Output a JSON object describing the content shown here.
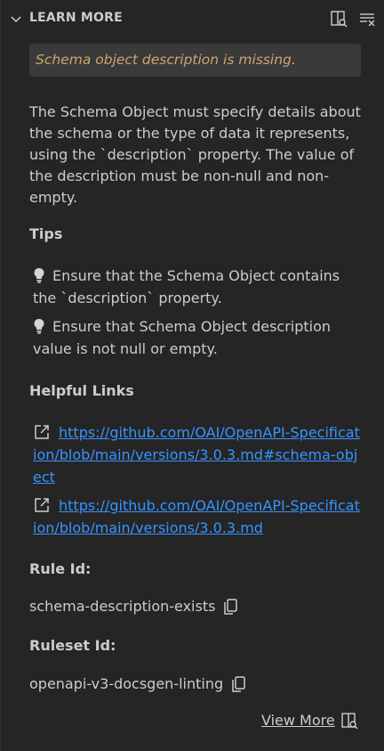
{
  "header": {
    "title": "LEARN MORE",
    "icons": [
      "chevron-down-icon",
      "open-preview-icon",
      "clear-all-icon"
    ]
  },
  "warning": {
    "text": "Schema object description is missing."
  },
  "description": "The Schema Object must specify details about the schema or the type of data it represents, using the `description` property. The value of the description must be non-null and non-empty.",
  "tips": {
    "heading": "Tips",
    "items": [
      "Ensure that the Schema Object contains the `description` property.",
      "Ensure that Schema Object description value is not null or empty."
    ]
  },
  "links": {
    "heading": "Helpful Links",
    "items": [
      "https://github.com/OAI/OpenAPI-Specification/blob/main/versions/3.0.3.md#schema-object",
      "https://github.com/OAI/OpenAPI-Specification/blob/main/versions/3.0.3.md"
    ]
  },
  "rule": {
    "label": "Rule Id:",
    "value": "schema-description-exists"
  },
  "ruleset": {
    "label": "Ruleset Id:",
    "value": "openapi-v3-docsgen-linting"
  },
  "view_more": {
    "label": "View More"
  },
  "colors": {
    "background": "#252526",
    "warning_text": "#cea46d",
    "link": "#3794ff",
    "text": "#cccccc"
  }
}
